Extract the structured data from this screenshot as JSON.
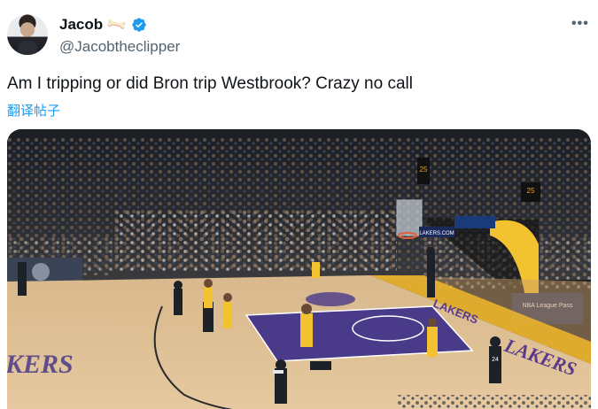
{
  "author": {
    "display_name": "Jacob",
    "handle": "@Jacobtheclipper",
    "emoji_icon": "bone-icon",
    "verified_icon": "verified-badge-icon",
    "verified_color": "#1d9bf0"
  },
  "menu": {
    "more_icon": "more-dots-icon",
    "more_label": "•••"
  },
  "tweet": {
    "text": "Am I tripping or did Bron trip Westbrook? Crazy no call",
    "translate_label": "翻译帖子"
  },
  "media": {
    "kind": "video-frame",
    "description_icon": "basketball-court-image",
    "scoreboard_top": "25",
    "scoreboard_right": "25",
    "baseline_sign_left": "LAKERS.COM",
    "baseline_sign_right": "NBA League Pass",
    "court_word_left": "KERS",
    "court_word_right": "LAKERS",
    "court_word_sideline": "LAKERS",
    "jersey_number": "24"
  }
}
